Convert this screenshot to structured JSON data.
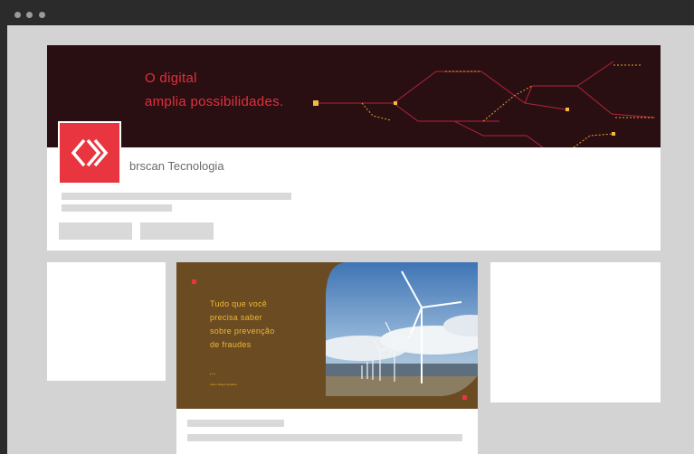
{
  "window": {
    "controls": [
      "close",
      "minimize",
      "maximize"
    ]
  },
  "profile": {
    "cover_lines": [
      "O digital",
      "amplia possibilidades."
    ],
    "company_name": "brscan Tecnologia",
    "logo_icon": "chevrons-logo-icon"
  },
  "post": {
    "ad_lines": [
      "Tudo que você",
      "precisa saber",
      "sobre prevenção",
      "de fraudes"
    ],
    "ad_ellipsis": "...",
    "ad_link": "Leia o artigo completo",
    "image": "wind-turbines-photo"
  },
  "colors": {
    "accent_red": "#e8353f",
    "cover_bg": "#2a0f12",
    "ad_bg": "#6a4b22",
    "ad_text": "#f0b830"
  }
}
